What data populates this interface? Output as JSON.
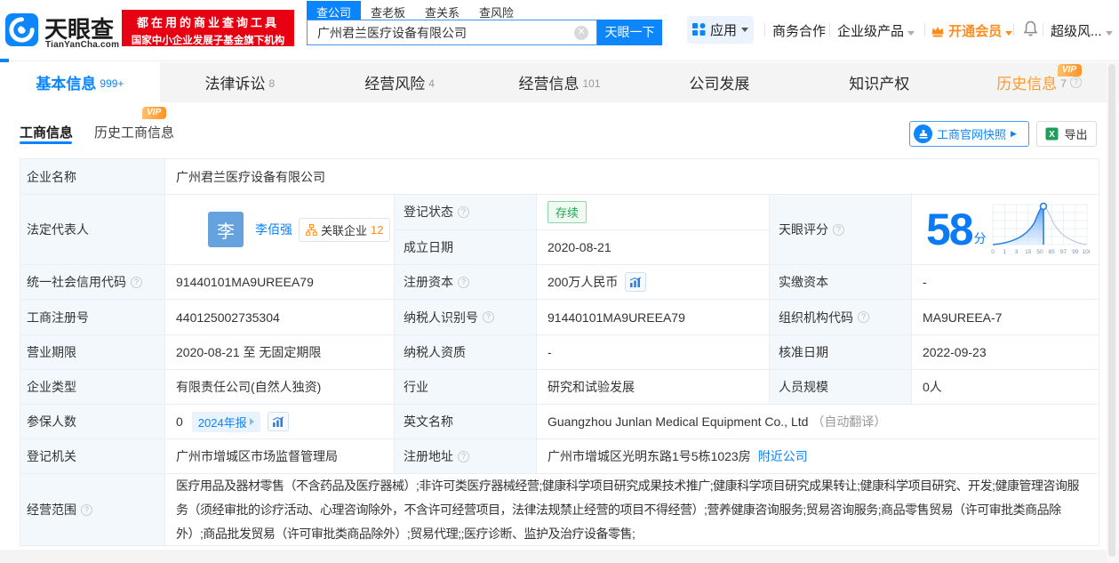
{
  "brand": {
    "name": "天眼查",
    "domain": "TianYanCha.com",
    "slogan_line1": "都在用的商业查询工具",
    "slogan_line2": "国家中小企业发展子基金旗下机构"
  },
  "search": {
    "tabs": [
      "查公司",
      "查老板",
      "查关系",
      "查风险"
    ],
    "active_tab": "查公司",
    "query": "广州君兰医疗设备有限公司",
    "button": "天眼一下"
  },
  "topnav": {
    "apps": "应用",
    "item1": "商务合作",
    "item2": "企业级产品",
    "vip": "开通会员",
    "more": "超级风..."
  },
  "tabs": [
    {
      "label": "基本信息",
      "count": "999+"
    },
    {
      "label": "法律诉讼",
      "count": "8"
    },
    {
      "label": "经营风险",
      "count": "4"
    },
    {
      "label": "经营信息",
      "count": "101"
    },
    {
      "label": "公司发展",
      "count": ""
    },
    {
      "label": "知识产权",
      "count": ""
    },
    {
      "label": "历史信息",
      "count": "7",
      "vip": "VIP"
    }
  ],
  "subtabs": {
    "tab1": "工商信息",
    "tab2": "历史工商信息",
    "vip": "VIP"
  },
  "actions": {
    "snapshot": "工商官网快照",
    "snapshot_arrow": "▶",
    "export": "导出"
  },
  "fields": {
    "company_name": {
      "label": "企业名称",
      "value": "广州君兰医疗设备有限公司"
    },
    "legal_rep": {
      "label": "法定代表人",
      "avatar": "李",
      "name": "李佰强",
      "related_label": "关联企业",
      "related_count": "12"
    },
    "reg_status": {
      "label": "登记状态",
      "value": "存续"
    },
    "establish_date": {
      "label": "成立日期",
      "value": "2020-08-21"
    },
    "score": {
      "label": "天眼评分",
      "value": "58",
      "unit": "分",
      "ticks": [
        "0",
        "1",
        "3",
        "15",
        "50",
        "85",
        "97",
        "99",
        "100"
      ]
    },
    "credit_code": {
      "label": "统一社会信用代码",
      "value": "91440101MA9UREEA79"
    },
    "reg_capital": {
      "label": "注册资本",
      "value": "200万人民币"
    },
    "paid_capital": {
      "label": "实缴资本",
      "value": "-"
    },
    "reg_number": {
      "label": "工商注册号",
      "value": "440125002735304"
    },
    "taxpayer_id": {
      "label": "纳税人识别号",
      "value": "91440101MA9UREEA79"
    },
    "org_code": {
      "label": "组织机构代码",
      "value": "MA9UREEA-7"
    },
    "business_term": {
      "label": "营业期限",
      "value": "2020-08-21 至 无固定期限"
    },
    "taxpayer_quality": {
      "label": "纳税人资质",
      "value": "-"
    },
    "approval_date": {
      "label": "核准日期",
      "value": "2022-09-23"
    },
    "company_type": {
      "label": "企业类型",
      "value": "有限责任公司(自然人独资)"
    },
    "industry": {
      "label": "行业",
      "value": "研究和试验发展"
    },
    "staff_size": {
      "label": "人员规模",
      "value": "0人"
    },
    "insured_count": {
      "label": "参保人数",
      "value": "0",
      "badge": "2024年报"
    },
    "english_name": {
      "label": "英文名称",
      "value": "Guangzhou Junlan Medical Equipment Co., Ltd",
      "note": "（自动翻译）"
    },
    "reg_authority": {
      "label": "登记机关",
      "value": "广州市增城区市场监督管理局"
    },
    "reg_address": {
      "label": "注册地址",
      "value": "广州市增城区光明东路1号5栋1023房",
      "link": "附近公司"
    },
    "business_scope": {
      "label": "经营范围",
      "value": "医疗用品及器材零售（不含药品及医疗器械）;非许可类医疗器械经营;健康科学项目研究成果技术推广;健康科学项目研究成果转让;健康科学项目研究、开发;健康管理咨询服务（须经审批的诊疗活动、心理咨询除外，不含许可经营项目，法律法规禁止经营的项目不得经营）;营养健康咨询服务;贸易咨询服务;商品零售贸易（许可审批类商品除外）;商品批发贸易（许可审批类商品除外）;贸易代理;;医疗诊断、监护及治疗设备零售;"
    }
  }
}
